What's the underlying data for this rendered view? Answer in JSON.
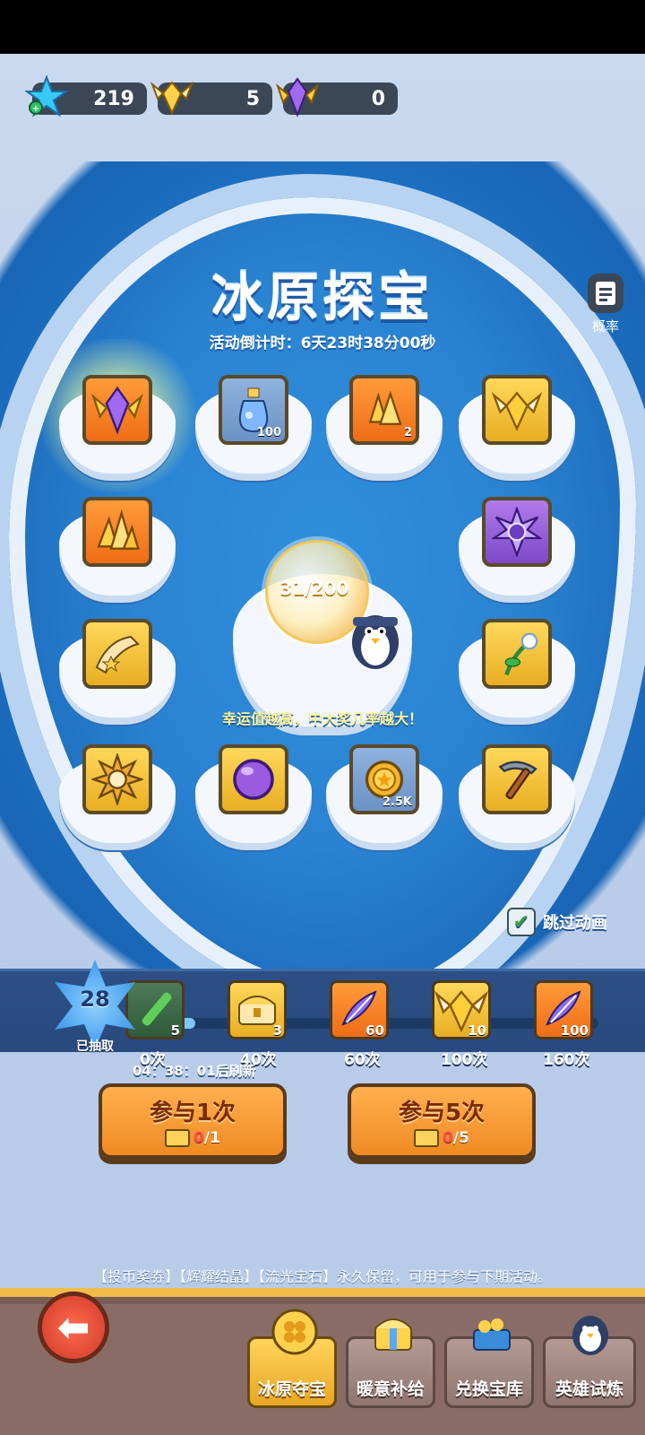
{
  "currencies": [
    {
      "name": "snowflake-crystal",
      "value": "219",
      "color": "#3ad0ff"
    },
    {
      "name": "gold-gem",
      "value": "5",
      "color": "#ffd04a"
    },
    {
      "name": "purple-gem",
      "value": "0",
      "color": "#a36cf0"
    }
  ],
  "title": "冰原探宝",
  "countdown": "活动倒计时：6天23时38分00秒",
  "probability_label": "概率",
  "prizes": [
    {
      "id": "purple-winged-gem",
      "style": "orange",
      "qty": "",
      "selected": true
    },
    {
      "id": "blue-potion",
      "style": "blue",
      "qty": "100",
      "selected": false
    },
    {
      "id": "gold-crystal",
      "style": "orange",
      "qty": "2",
      "selected": false
    },
    {
      "id": "gold-winged-gem",
      "style": "gold",
      "qty": "",
      "selected": false
    },
    {
      "id": "gold-crystal-big",
      "style": "orange",
      "qty": "",
      "selected": false
    },
    {
      "id": "purple-star-gem",
      "style": "purple",
      "qty": "",
      "selected": false
    },
    {
      "id": "scroll",
      "style": "gold",
      "qty": "",
      "selected": false
    },
    {
      "id": "snow-plant",
      "style": "gold",
      "qty": "",
      "selected": false
    },
    {
      "id": "sun-emblem",
      "style": "gold",
      "qty": "",
      "selected": false
    },
    {
      "id": "purple-orb",
      "style": "gold",
      "qty": "",
      "selected": false
    },
    {
      "id": "gold-coin",
      "style": "blue",
      "qty": "2.5K",
      "selected": false
    },
    {
      "id": "pickaxe",
      "style": "gold",
      "qty": "",
      "selected": false
    }
  ],
  "luck": {
    "progress_text": "31/200",
    "hint": "幸运值越高，中大奖几率越大！"
  },
  "skip_animation": {
    "label": "跳过动画",
    "checked": true
  },
  "draw_count": {
    "value": "28",
    "label": "已抽取"
  },
  "milestones": [
    {
      "label": "0次",
      "qty": "5",
      "style": "blue"
    },
    {
      "label": "40次",
      "qty": "3",
      "style": "gold"
    },
    {
      "label": "60次",
      "qty": "60",
      "style": "orange"
    },
    {
      "label": "100次",
      "qty": "10",
      "style": "gold"
    },
    {
      "label": "160次",
      "qty": "100",
      "style": "orange"
    }
  ],
  "refresh_text": "04：38：01后刷新",
  "buttons": {
    "draw1": {
      "label": "参与1次",
      "cost": "0",
      "limit": "/1"
    },
    "draw5": {
      "label": "参与5次",
      "cost": "0",
      "limit": "/5"
    }
  },
  "notice": "【投币奖券】【辉耀结晶】【流光宝石】永久保留，可用于参与下期活动。",
  "nav": [
    {
      "label": "冰原夺宝",
      "active": true
    },
    {
      "label": "暖意补给",
      "active": false
    },
    {
      "label": "兑换宝库",
      "active": false
    },
    {
      "label": "英雄试炼",
      "active": false
    }
  ]
}
